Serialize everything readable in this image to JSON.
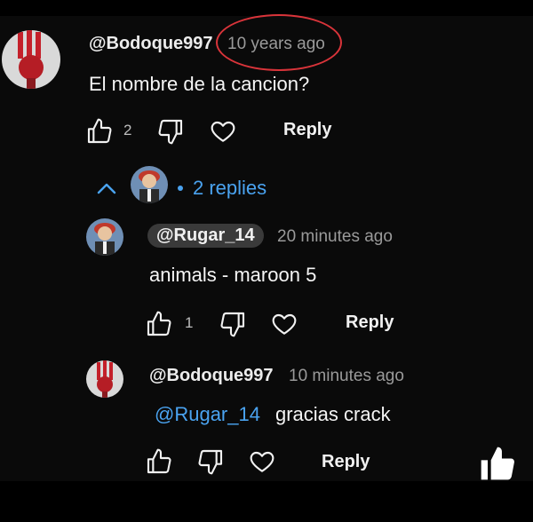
{
  "comment": {
    "author": "@Bodoque997",
    "timestamp": "10 years ago",
    "text": "El nombre de la cancion?",
    "like_count": "2",
    "reply_label": "Reply",
    "replies_toggle": "2 replies"
  },
  "replies": [
    {
      "author": "@Rugar_14",
      "timestamp": "20 minutes ago",
      "text": "animals - maroon 5",
      "like_count": "1",
      "reply_label": "Reply"
    },
    {
      "author": "@Bodoque997",
      "timestamp": "10 minutes ago",
      "mention": "@Rugar_14",
      "text": "gracias crack",
      "reply_label": "Reply"
    }
  ],
  "colors": {
    "background": "#0a0a0a",
    "link_blue": "#4aa3f0",
    "highlight_red": "#d9343a"
  },
  "icons": [
    "thumbs-up-icon",
    "thumbs-down-icon",
    "heart-icon",
    "chevron-up-icon",
    "like-watermark-icon"
  ]
}
